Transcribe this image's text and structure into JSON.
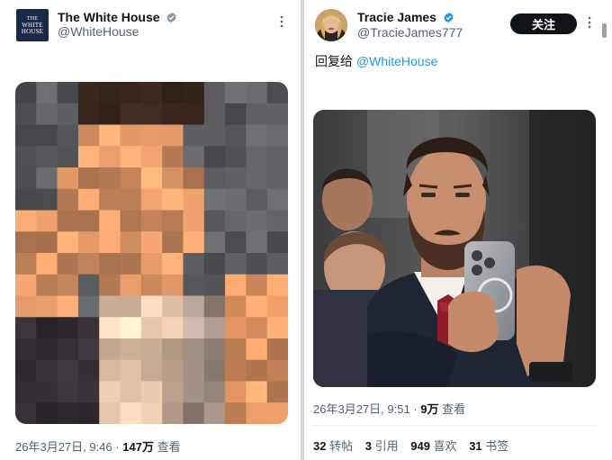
{
  "left_tweet": {
    "account_name": "The White House",
    "handle": "@WhiteHouse",
    "avatar_text": [
      "THE",
      "WHITE",
      "HOUSE"
    ],
    "timestamp": "26年3月27日, 9:46",
    "separator": " · ",
    "views_count": "147万",
    "views_label": "查看",
    "media_icon": "pixelated-photo"
  },
  "right_tweet": {
    "account_name": "Tracie James",
    "handle": "@TracieJames777",
    "follow_label": "关注",
    "reply_prefix": "回复给 ",
    "reply_target": "@WhiteHouse",
    "timestamp": "26年3月27日, 9:51",
    "separator": " · ",
    "views_count": "9万",
    "views_label": "查看",
    "stats": {
      "retweets_count": "32",
      "retweets_label": "转帖",
      "quotes_count": "3",
      "quotes_label": "引用",
      "likes_count": "949",
      "likes_label": "喜欢",
      "bookmarks_count": "31",
      "bookmarks_label": "书签"
    }
  },
  "colors": {
    "verified": "#1d9bf0",
    "link": "#1d9bf0",
    "follow_button": "#0f1419",
    "secondary_text": "#536471"
  }
}
